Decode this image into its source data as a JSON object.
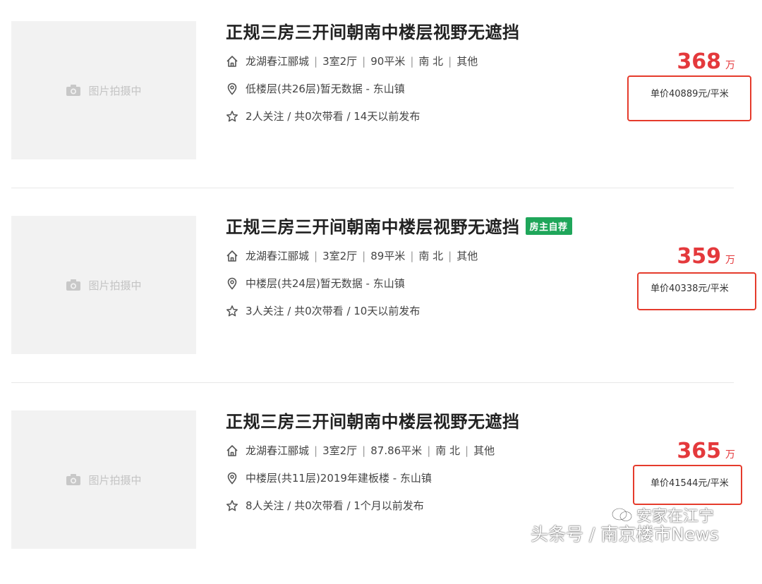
{
  "listings": [
    {
      "title": "正规三房三开间朝南中楼层视野无遮挡",
      "tag": "",
      "image_placeholder": "图片拍摄中",
      "community": "龙湖春江郦城",
      "layout": "3室2厅",
      "area": "90平米",
      "orientation": "南 北",
      "decoration": "其他",
      "floor_info": "低楼层(共26层)暂无数据 - 东山镇",
      "follow_info": "2人关注 / 共0次带看 / 14天以前发布",
      "total_price": "368",
      "price_unit": "万",
      "unit_price": "单价40889元/平米"
    },
    {
      "title": "正规三房三开间朝南中楼层视野无遮挡",
      "tag": "房主自荐",
      "image_placeholder": "图片拍摄中",
      "community": "龙湖春江郦城",
      "layout": "3室2厅",
      "area": "89平米",
      "orientation": "南 北",
      "decoration": "其他",
      "floor_info": "中楼层(共24层)暂无数据 - 东山镇",
      "follow_info": "3人关注 / 共0次带看 / 10天以前发布",
      "total_price": "359",
      "price_unit": "万",
      "unit_price": "单价40338元/平米"
    },
    {
      "title": "正规三房三开间朝南中楼层视野无遮挡",
      "tag": "",
      "image_placeholder": "图片拍摄中",
      "community": "龙湖春江郦城",
      "layout": "3室2厅",
      "area": "87.86平米",
      "orientation": "南 北",
      "decoration": "其他",
      "floor_info": "中楼层(共11层)2019年建板楼 - 东山镇",
      "follow_info": "8人关注 / 共0次带看 / 1个月以前发布",
      "total_price": "365",
      "price_unit": "万",
      "unit_price": "单价41544元/平米"
    }
  ],
  "watermark": {
    "line1": "安家在江宁",
    "line2": "头条号 / 南京楼市News"
  },
  "colors": {
    "price_red": "#e4393c",
    "highlight_box": "#e53b2c",
    "tag_green": "#1fa65a"
  },
  "icons": [
    "house-icon",
    "location-pin-icon",
    "star-icon",
    "camera-icon",
    "wechat-icon"
  ]
}
